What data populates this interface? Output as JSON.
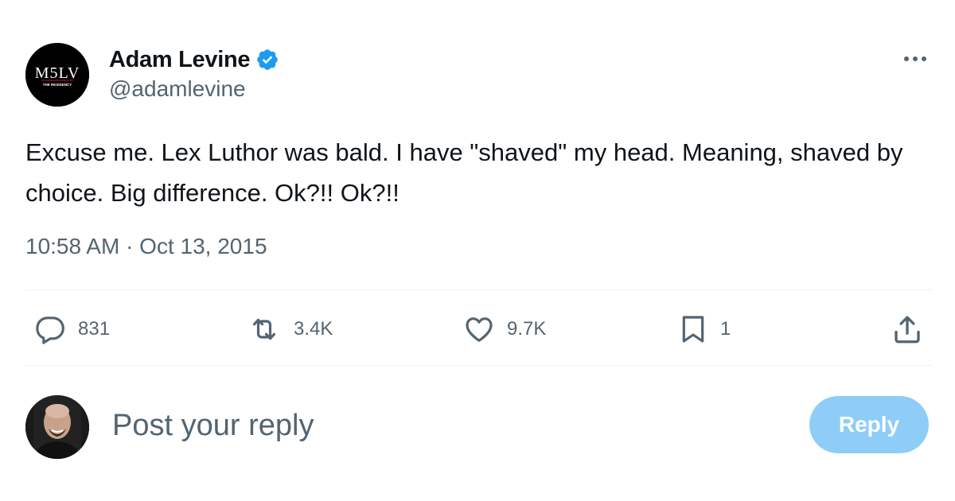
{
  "author": {
    "display_name": "Adam Levine",
    "handle": "@adamlevine",
    "verified": true,
    "avatar_text": "M5LV",
    "avatar_subtext": "THE RESIDENCY"
  },
  "tweet": {
    "text": "Excuse me. Lex Luthor was bald. I have \"shaved\" my head. Meaning, shaved by choice. Big difference. Ok?!! Ok?!!",
    "timestamp": "10:58 AM · Oct 13, 2015"
  },
  "actions": {
    "replies": "831",
    "retweets": "3.4K",
    "likes": "9.7K",
    "bookmarks": "1"
  },
  "icons": {
    "reply": "speech-bubble-icon",
    "retweet": "retweet-icon",
    "like": "heart-icon",
    "bookmark": "bookmark-icon",
    "share": "share-icon",
    "more": "more-dots-icon",
    "verified": "verified-badge-icon"
  },
  "composer": {
    "placeholder": "Post your reply",
    "value": "",
    "reply_button_label": "Reply"
  },
  "colors": {
    "text_primary": "#0f1419",
    "text_secondary": "#536471",
    "verified_blue": "#1d9bf0",
    "reply_button_disabled": "#8ecdf7",
    "divider": "#eff3f4"
  }
}
